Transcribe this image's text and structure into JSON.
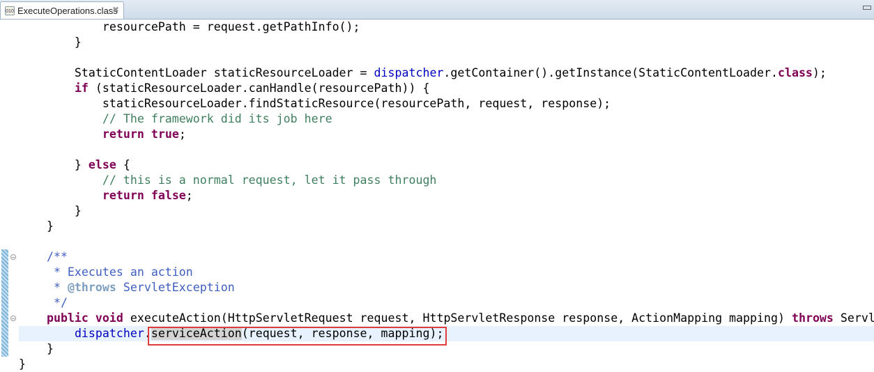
{
  "tab": {
    "label": "ExecuteOperations.class",
    "icon": "class-file-icon",
    "close_icon": "close-icon"
  },
  "colors": {
    "keyword": "#7f0055",
    "field": "#0000c0",
    "comment": "#3f7f5f",
    "javadoc": "#3f5fbf",
    "current_line": "#e8f2fe",
    "highlight_box": "#e03c3c"
  },
  "current_line_index": 20,
  "lines": [
    [
      {
        "t": "            resourcePath = request.getPathInfo();",
        "c": ""
      }
    ],
    [
      {
        "t": "        }",
        "c": ""
      }
    ],
    [],
    [
      {
        "t": "        StaticContentLoader staticResourceLoader = ",
        "c": ""
      },
      {
        "t": "dispatcher",
        "c": "fld"
      },
      {
        "t": ".getContainer().getInstance(StaticContentLoader.",
        "c": ""
      },
      {
        "t": "class",
        "c": "kw"
      },
      {
        "t": ");",
        "c": ""
      }
    ],
    [
      {
        "t": "        ",
        "c": ""
      },
      {
        "t": "if",
        "c": "kw"
      },
      {
        "t": " (staticResourceLoader.canHandle(resourcePath)) {",
        "c": ""
      }
    ],
    [
      {
        "t": "            staticResourceLoader.findStaticResource(resourcePath, request, response);",
        "c": ""
      }
    ],
    [
      {
        "t": "            ",
        "c": ""
      },
      {
        "t": "// The framework did its job here",
        "c": "cm"
      }
    ],
    [
      {
        "t": "            ",
        "c": ""
      },
      {
        "t": "return",
        "c": "kw"
      },
      {
        "t": " ",
        "c": ""
      },
      {
        "t": "true",
        "c": "kw"
      },
      {
        "t": ";",
        "c": ""
      }
    ],
    [],
    [
      {
        "t": "        } ",
        "c": ""
      },
      {
        "t": "else",
        "c": "kw"
      },
      {
        "t": " {",
        "c": ""
      }
    ],
    [
      {
        "t": "            ",
        "c": ""
      },
      {
        "t": "// this is a normal request, let it pass through",
        "c": "cm"
      }
    ],
    [
      {
        "t": "            ",
        "c": ""
      },
      {
        "t": "return",
        "c": "kw"
      },
      {
        "t": " ",
        "c": ""
      },
      {
        "t": "false",
        "c": "kw"
      },
      {
        "t": ";",
        "c": ""
      }
    ],
    [
      {
        "t": "        }",
        "c": ""
      }
    ],
    [
      {
        "t": "    }",
        "c": ""
      }
    ],
    [],
    [
      {
        "t": "    ",
        "c": ""
      },
      {
        "t": "/**",
        "c": "jd"
      }
    ],
    [
      {
        "t": "     * Executes an action",
        "c": "jd"
      }
    ],
    [
      {
        "t": "     * ",
        "c": "jd"
      },
      {
        "t": "@throws",
        "c": "jt"
      },
      {
        "t": " ServletException",
        "c": "jd"
      }
    ],
    [
      {
        "t": "     */",
        "c": "jd"
      }
    ],
    [
      {
        "t": "    ",
        "c": ""
      },
      {
        "t": "public",
        "c": "kw"
      },
      {
        "t": " ",
        "c": ""
      },
      {
        "t": "void",
        "c": "kw"
      },
      {
        "t": " executeAction(HttpServletRequest request, HttpServletResponse response, ActionMapping mapping) ",
        "c": ""
      },
      {
        "t": "throws",
        "c": "kw"
      },
      {
        "t": " Servl",
        "c": ""
      }
    ],
    [
      {
        "t": "        ",
        "c": ""
      },
      {
        "t": "dispatcher",
        "c": "fld"
      },
      {
        "t": ".",
        "c": ""
      },
      {
        "t": "serviceAction",
        "c": "hl"
      },
      {
        "t": "(request, response, mapping);",
        "c": ""
      }
    ],
    [
      {
        "t": "    }",
        "c": ""
      }
    ],
    [
      {
        "t": "}",
        "c": ""
      }
    ]
  ]
}
